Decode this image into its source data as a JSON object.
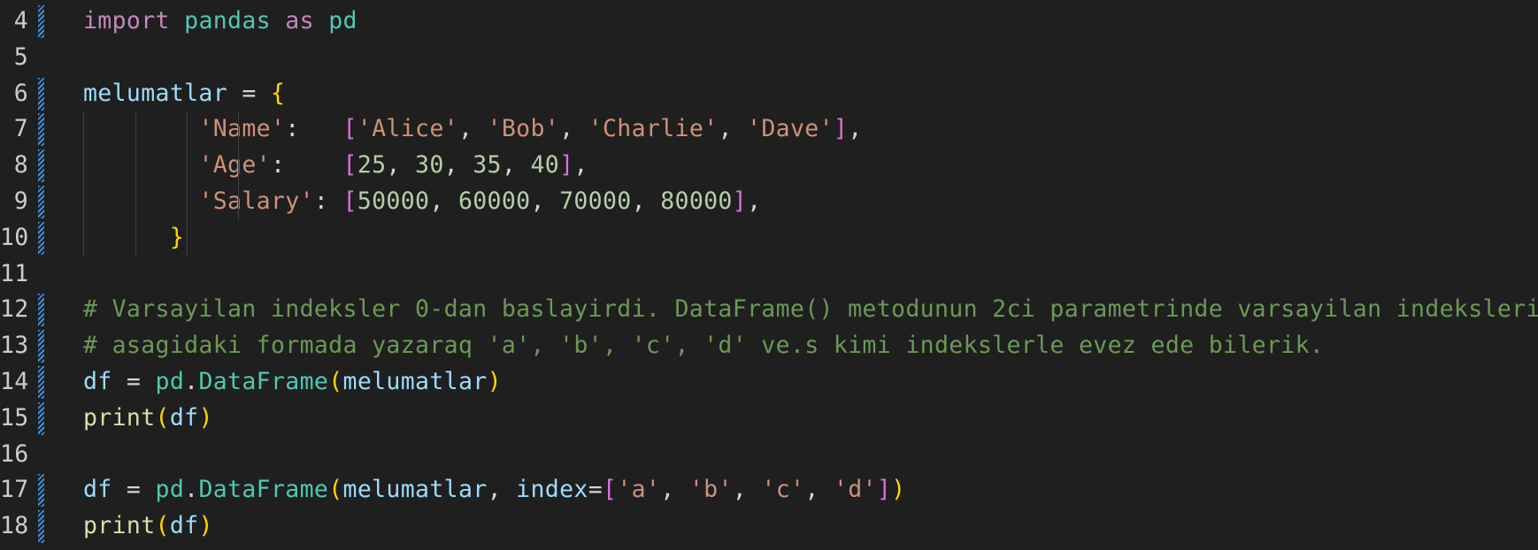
{
  "editor": {
    "lines": [
      {
        "num": "4",
        "changed": true,
        "tokens": [
          {
            "t": "import",
            "c": "kw"
          },
          {
            "t": " ",
            "c": "op"
          },
          {
            "t": "pandas",
            "c": "mod"
          },
          {
            "t": " ",
            "c": "op"
          },
          {
            "t": "as",
            "c": "kw"
          },
          {
            "t": " ",
            "c": "op"
          },
          {
            "t": "pd",
            "c": "mod"
          }
        ]
      },
      {
        "num": "5",
        "changed": false,
        "tokens": []
      },
      {
        "num": "6",
        "changed": true,
        "tokens": [
          {
            "t": "melumatlar",
            "c": "var"
          },
          {
            "t": " = ",
            "c": "op"
          },
          {
            "t": "{",
            "c": "br1"
          }
        ]
      },
      {
        "num": "7",
        "changed": true,
        "tokens": [
          {
            "t": "        ",
            "c": "op"
          },
          {
            "t": "'Name'",
            "c": "str"
          },
          {
            "t": ":   ",
            "c": "op"
          },
          {
            "t": "[",
            "c": "br2"
          },
          {
            "t": "'Alice'",
            "c": "str"
          },
          {
            "t": ", ",
            "c": "op"
          },
          {
            "t": "'Bob'",
            "c": "str"
          },
          {
            "t": ", ",
            "c": "op"
          },
          {
            "t": "'Charlie'",
            "c": "str"
          },
          {
            "t": ", ",
            "c": "op"
          },
          {
            "t": "'Dave'",
            "c": "str"
          },
          {
            "t": "]",
            "c": "br2"
          },
          {
            "t": ",",
            "c": "op"
          }
        ]
      },
      {
        "num": "8",
        "changed": true,
        "tokens": [
          {
            "t": "        ",
            "c": "op"
          },
          {
            "t": "'Age'",
            "c": "str"
          },
          {
            "t": ":    ",
            "c": "op"
          },
          {
            "t": "[",
            "c": "br2"
          },
          {
            "t": "25",
            "c": "num"
          },
          {
            "t": ", ",
            "c": "op"
          },
          {
            "t": "30",
            "c": "num"
          },
          {
            "t": ", ",
            "c": "op"
          },
          {
            "t": "35",
            "c": "num"
          },
          {
            "t": ", ",
            "c": "op"
          },
          {
            "t": "40",
            "c": "num"
          },
          {
            "t": "]",
            "c": "br2"
          },
          {
            "t": ",",
            "c": "op"
          }
        ]
      },
      {
        "num": "9",
        "changed": true,
        "tokens": [
          {
            "t": "        ",
            "c": "op"
          },
          {
            "t": "'Salary'",
            "c": "str"
          },
          {
            "t": ": ",
            "c": "op"
          },
          {
            "t": "[",
            "c": "br2"
          },
          {
            "t": "50000",
            "c": "num"
          },
          {
            "t": ", ",
            "c": "op"
          },
          {
            "t": "60000",
            "c": "num"
          },
          {
            "t": ", ",
            "c": "op"
          },
          {
            "t": "70000",
            "c": "num"
          },
          {
            "t": ", ",
            "c": "op"
          },
          {
            "t": "80000",
            "c": "num"
          },
          {
            "t": "]",
            "c": "br2"
          },
          {
            "t": ",",
            "c": "op"
          }
        ]
      },
      {
        "num": "10",
        "changed": true,
        "tokens": [
          {
            "t": "      ",
            "c": "op"
          },
          {
            "t": "}",
            "c": "br1"
          }
        ]
      },
      {
        "num": "11",
        "changed": false,
        "tokens": []
      },
      {
        "num": "12",
        "changed": true,
        "tokens": [
          {
            "t": "# Varsayilan indeksler 0-dan baslayirdi. DataFrame() metodunun 2ci parametrinde varsayilan indeksleri",
            "c": "cmt"
          }
        ]
      },
      {
        "num": "13",
        "changed": true,
        "tokens": [
          {
            "t": "# asagidaki formada yazaraq 'a', 'b', 'c', 'd' ve.s kimi indekslerle evez ede bilerik.",
            "c": "cmt"
          }
        ]
      },
      {
        "num": "14",
        "changed": true,
        "tokens": [
          {
            "t": "df",
            "c": "var"
          },
          {
            "t": " = ",
            "c": "op"
          },
          {
            "t": "pd",
            "c": "mod"
          },
          {
            "t": ".",
            "c": "op"
          },
          {
            "t": "DataFrame",
            "c": "cls"
          },
          {
            "t": "(",
            "c": "br1"
          },
          {
            "t": "melumatlar",
            "c": "var"
          },
          {
            "t": ")",
            "c": "br1"
          }
        ]
      },
      {
        "num": "15",
        "changed": true,
        "tokens": [
          {
            "t": "print",
            "c": "fn"
          },
          {
            "t": "(",
            "c": "br1"
          },
          {
            "t": "df",
            "c": "var"
          },
          {
            "t": ")",
            "c": "br1"
          }
        ]
      },
      {
        "num": "16",
        "changed": false,
        "tokens": []
      },
      {
        "num": "17",
        "changed": true,
        "tokens": [
          {
            "t": "df",
            "c": "var"
          },
          {
            "t": " = ",
            "c": "op"
          },
          {
            "t": "pd",
            "c": "mod"
          },
          {
            "t": ".",
            "c": "op"
          },
          {
            "t": "DataFrame",
            "c": "cls"
          },
          {
            "t": "(",
            "c": "br1"
          },
          {
            "t": "melumatlar",
            "c": "var"
          },
          {
            "t": ", ",
            "c": "op"
          },
          {
            "t": "index",
            "c": "var"
          },
          {
            "t": "=",
            "c": "op"
          },
          {
            "t": "[",
            "c": "br2"
          },
          {
            "t": "'a'",
            "c": "str"
          },
          {
            "t": ", ",
            "c": "op"
          },
          {
            "t": "'b'",
            "c": "str"
          },
          {
            "t": ", ",
            "c": "op"
          },
          {
            "t": "'c'",
            "c": "str"
          },
          {
            "t": ", ",
            "c": "op"
          },
          {
            "t": "'d'",
            "c": "str"
          },
          {
            "t": "]",
            "c": "br2"
          },
          {
            "t": ")",
            "c": "br1"
          }
        ]
      },
      {
        "num": "18",
        "changed": true,
        "tokens": [
          {
            "t": "print",
            "c": "fn"
          },
          {
            "t": "(",
            "c": "br1"
          },
          {
            "t": "df",
            "c": "var"
          },
          {
            "t": ")",
            "c": "br1"
          }
        ]
      }
    ]
  },
  "colors": {
    "background": "#1f1f1f",
    "keyword": "#c586c0",
    "module": "#4ec9b0",
    "variable": "#9cdcfe",
    "string": "#ce9178",
    "number": "#b5cea8",
    "comment": "#6a9955",
    "function": "#dcdcaa",
    "bracket_level1": "#ffd700",
    "bracket_level2": "#da70d6",
    "gutter_change": "#3b8fe0"
  }
}
